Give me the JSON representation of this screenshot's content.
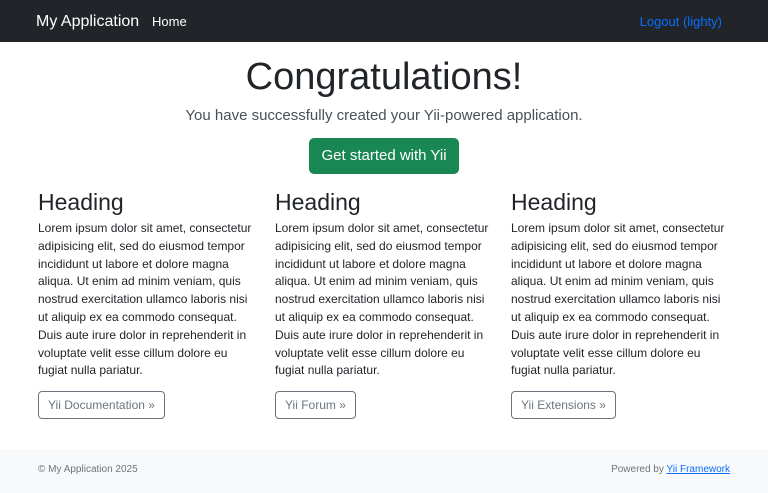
{
  "navbar": {
    "brand": "My Application",
    "home": "Home",
    "logout": "Logout (lighty)"
  },
  "hero": {
    "title": "Congratulations!",
    "lead": "You have successfully created your Yii-powered application.",
    "button": "Get started with Yii"
  },
  "columns": [
    {
      "heading": "Heading",
      "text": "Lorem ipsum dolor sit amet, consectetur adipisicing elit, sed do eiusmod tempor incididunt ut labore et dolore magna aliqua. Ut enim ad minim veniam, quis nostrud exercitation ullamco laboris nisi ut aliquip ex ea commodo consequat. Duis aute irure dolor in reprehenderit in voluptate velit esse cillum dolore eu fugiat nulla pariatur.",
      "button": "Yii Documentation »"
    },
    {
      "heading": "Heading",
      "text": "Lorem ipsum dolor sit amet, consectetur adipisicing elit, sed do eiusmod tempor incididunt ut labore et dolore magna aliqua. Ut enim ad minim veniam, quis nostrud exercitation ullamco laboris nisi ut aliquip ex ea commodo consequat. Duis aute irure dolor in reprehenderit in voluptate velit esse cillum dolore eu fugiat nulla pariatur.",
      "button": "Yii Forum »"
    },
    {
      "heading": "Heading",
      "text": "Lorem ipsum dolor sit amet, consectetur adipisicing elit, sed do eiusmod tempor incididunt ut labore et dolore magna aliqua. Ut enim ad minim veniam, quis nostrud exercitation ullamco laboris nisi ut aliquip ex ea commodo consequat. Duis aute irure dolor in reprehenderit in voluptate velit esse cillum dolore eu fugiat nulla pariatur.",
      "button": "Yii Extensions »"
    }
  ],
  "footer": {
    "copyright": "© My Application 2025",
    "powered_prefix": "Powered by ",
    "powered_link": "Yii Framework"
  },
  "colors": {
    "navbar_bg": "#212529",
    "link_blue": "#0d6efd",
    "success": "#198754",
    "outline_gray": "#6c757d",
    "footer_bg": "#f8f9fa"
  }
}
